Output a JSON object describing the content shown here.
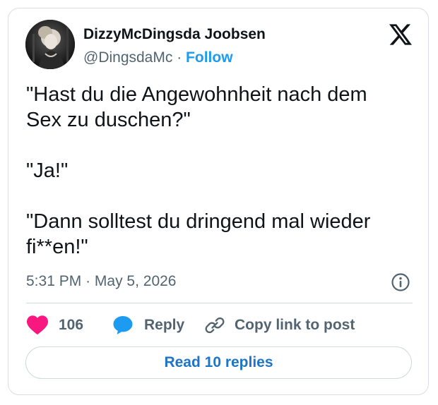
{
  "author": {
    "name": "DizzyMcDingsda Joobsen",
    "handle": "@DingsdaMc",
    "separator": "·",
    "follow_label": "Follow"
  },
  "icons": {
    "brand": "x-logo-icon",
    "like": "heart-icon",
    "reply": "speech-bubble-icon",
    "copy": "link-icon",
    "info": "info-icon"
  },
  "tweet": {
    "text": "\"Hast du die Angewohnheit nach dem Sex zu duschen?\"\n\n\"Ja!\"\n\n\"Dann solltest du dringend mal wieder fi**en!\"",
    "time": "5:31 PM",
    "separator": "·",
    "date": "May 5, 2026"
  },
  "actions": {
    "like_count": "106",
    "reply_label": "Reply",
    "copy_label": "Copy link to post",
    "read_replies_label": "Read 10 replies"
  },
  "colors": {
    "like": "#f91880",
    "reply": "#1d9bf0",
    "follow": "#1d9bf0",
    "text_primary": "#0f1419",
    "text_secondary": "#536471"
  }
}
